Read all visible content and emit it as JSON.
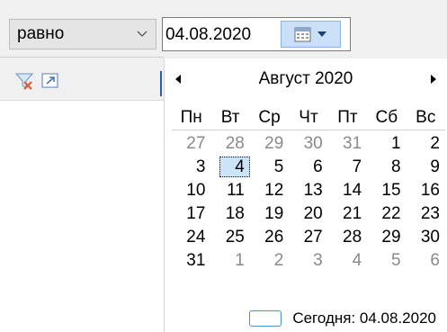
{
  "filter": {
    "operator": "равно",
    "date_value": "04.08.2020"
  },
  "icons": {
    "clear_filter": "filter-clear-icon",
    "open_external": "open-external-icon",
    "calendar_button": "calendar-icon",
    "dropdown_arrow": "chevron-down-icon"
  },
  "calendar": {
    "month_title": "Август 2020",
    "weekdays": [
      "Пн",
      "Вт",
      "Ср",
      "Чт",
      "Пт",
      "Сб",
      "Вс"
    ],
    "weeks": [
      [
        "27",
        "28",
        "29",
        "30",
        "31",
        "1",
        "2"
      ],
      [
        "3",
        "4",
        "5",
        "6",
        "7",
        "8",
        "9"
      ],
      [
        "10",
        "11",
        "12",
        "13",
        "14",
        "15",
        "16"
      ],
      [
        "17",
        "18",
        "19",
        "20",
        "21",
        "22",
        "23"
      ],
      [
        "24",
        "25",
        "26",
        "27",
        "28",
        "29",
        "30"
      ],
      [
        "31",
        "1",
        "2",
        "3",
        "4",
        "5",
        "6"
      ]
    ],
    "other_month": [
      [
        true,
        true,
        true,
        true,
        true,
        false,
        false
      ],
      [
        false,
        false,
        false,
        false,
        false,
        false,
        false
      ],
      [
        false,
        false,
        false,
        false,
        false,
        false,
        false
      ],
      [
        false,
        false,
        false,
        false,
        false,
        false,
        false
      ],
      [
        false,
        false,
        false,
        false,
        false,
        false,
        false
      ],
      [
        false,
        true,
        true,
        true,
        true,
        true,
        true
      ]
    ],
    "selected": {
      "week": 1,
      "day": 1
    },
    "today_label": "Сегодня: 04.08.2020"
  },
  "colors": {
    "selected_bg": "#cce4f7",
    "button_bg": "#c9e0f7",
    "other_month_text": "#8a8a8a",
    "filter_icon_accent": "#e05a3a"
  }
}
